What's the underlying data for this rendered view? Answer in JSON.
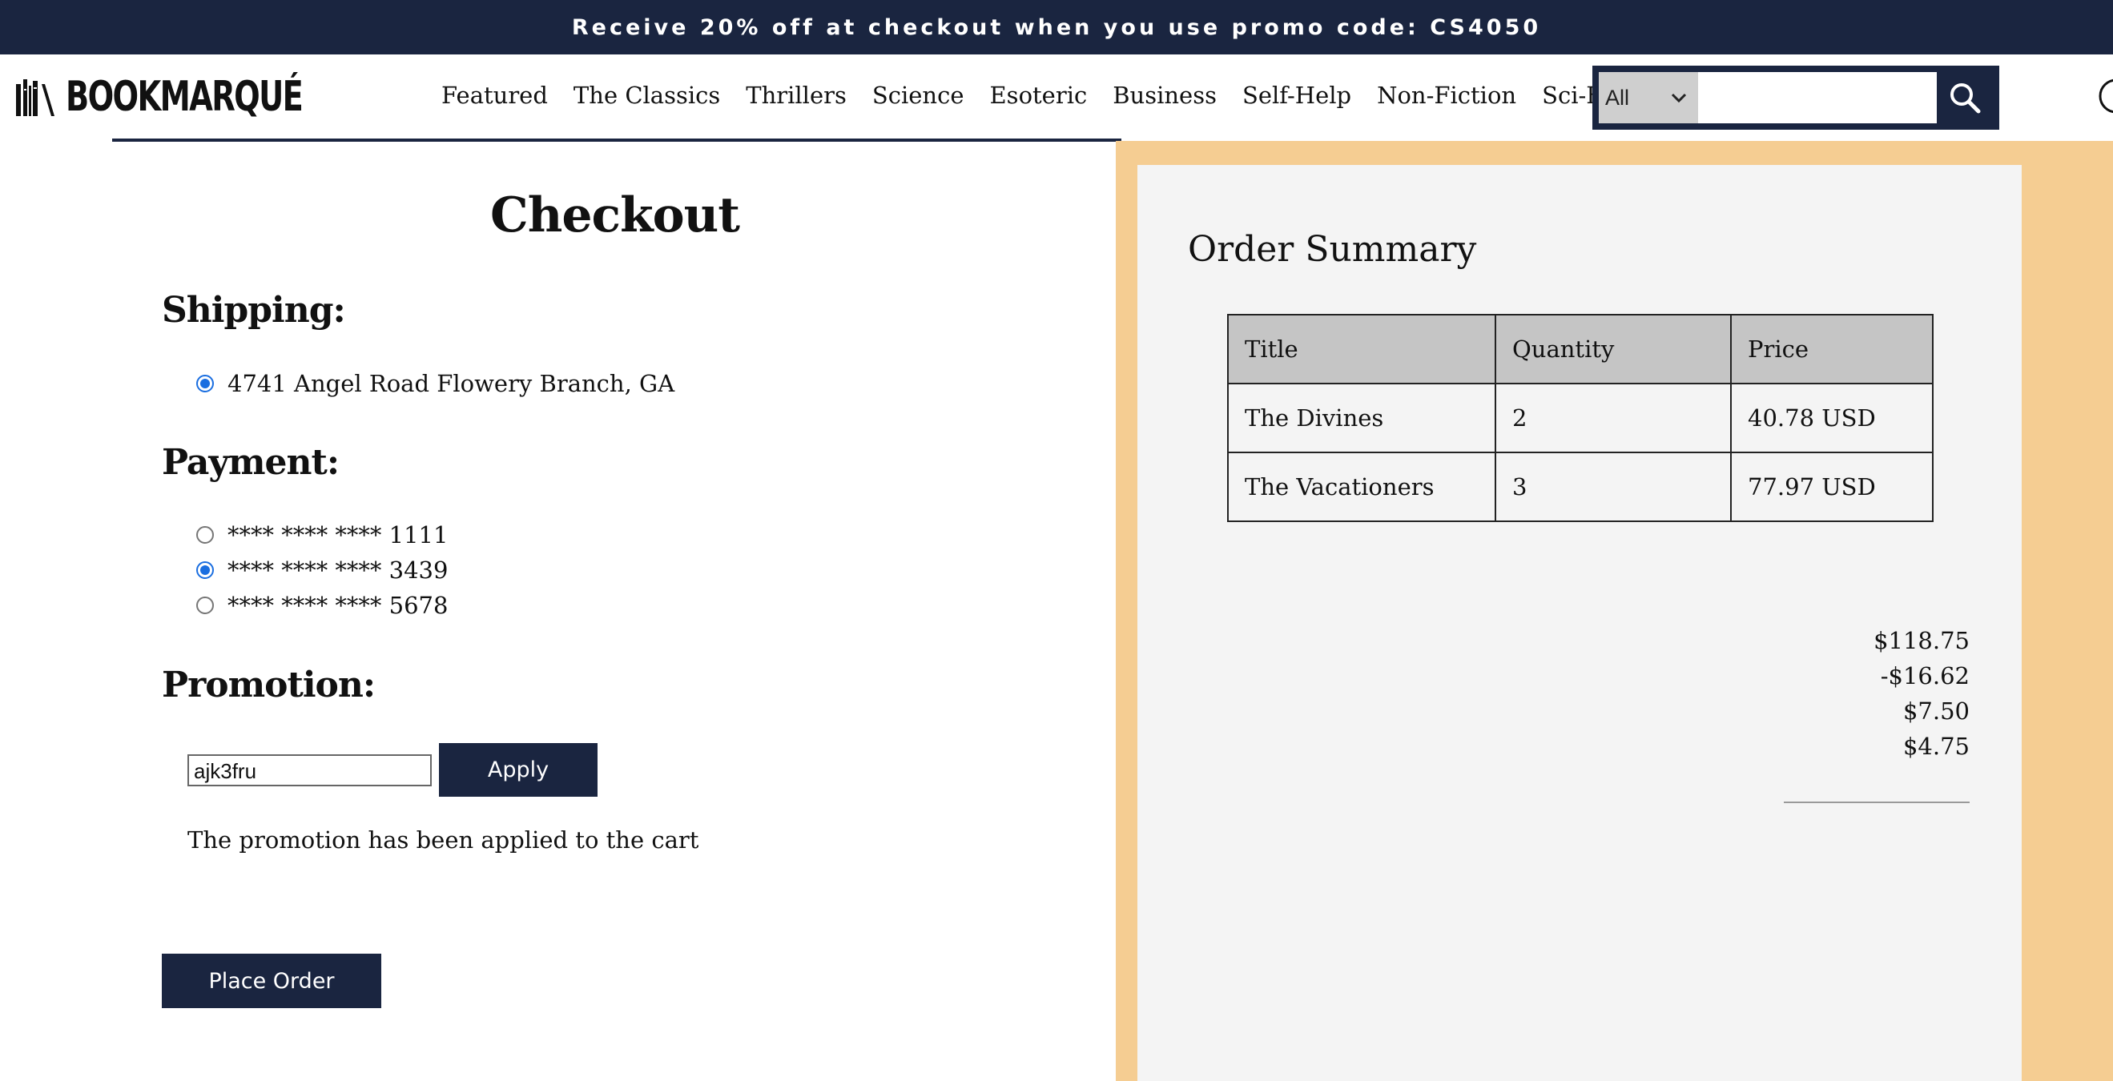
{
  "banner": {
    "text": "Receive 20% off at checkout when you use promo code: CS4050"
  },
  "header": {
    "logo_text": "BOOKMARQUÉ",
    "nav": [
      "Featured",
      "The Classics",
      "Thrillers",
      "Science",
      "Esoteric",
      "Business",
      "Self-Help",
      "Non-Fiction",
      "Sci-Fi"
    ],
    "search": {
      "category": "All",
      "placeholder": ""
    }
  },
  "checkout": {
    "title": "Checkout",
    "shipping": {
      "heading": "Shipping:",
      "options": [
        {
          "label": "4741 Angel Road Flowery Branch, GA",
          "checked": true
        }
      ]
    },
    "payment": {
      "heading": "Payment:",
      "options": [
        {
          "label": "**** **** **** 1111",
          "checked": false
        },
        {
          "label": "**** **** **** 3439",
          "checked": true
        },
        {
          "label": "**** **** **** 5678",
          "checked": false
        }
      ]
    },
    "promotion": {
      "heading": "Promotion:",
      "code": "ajk3fru",
      "apply_label": "Apply",
      "message": "The promotion has been applied to the cart"
    },
    "place_order_label": "Place Order"
  },
  "summary": {
    "title": "Order Summary",
    "columns": [
      "Title",
      "Quantity",
      "Price"
    ],
    "rows": [
      [
        "The Divines",
        "2",
        "40.78 USD"
      ],
      [
        "The Vacationers",
        "3",
        "77.97 USD"
      ]
    ],
    "totals": [
      "$118.75",
      "-$16.62",
      "$7.50",
      "$4.75"
    ]
  },
  "colors": {
    "navy": "#1a2540",
    "accent_panel": "#f5cd92",
    "radio_checked": "#1a6ee0"
  }
}
